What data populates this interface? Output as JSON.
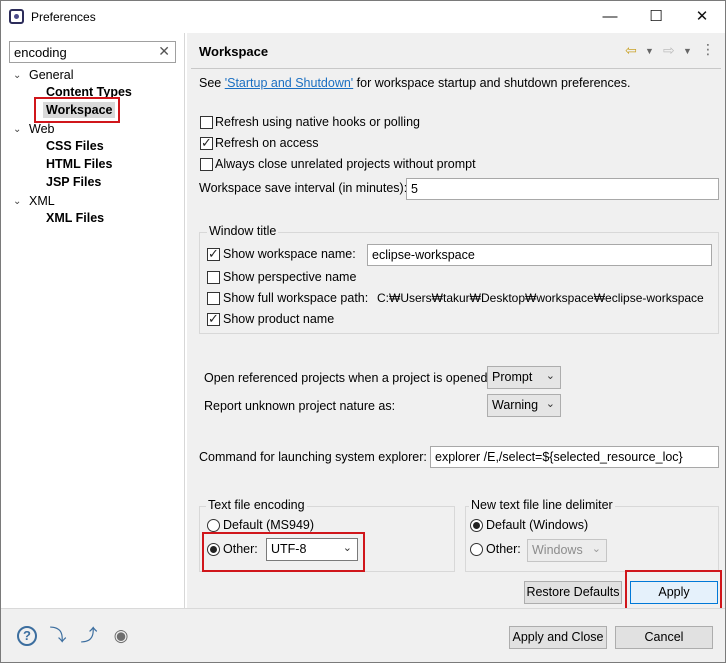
{
  "window": {
    "title": "Preferences",
    "minimize": "—",
    "maximize": "☐",
    "close": "✕"
  },
  "sidebar": {
    "filter_value": "encoding",
    "clear_icon": "✕",
    "tree": [
      {
        "label": "General",
        "expanded": true,
        "children": [
          "Content Types",
          "Workspace"
        ]
      },
      {
        "label": "Web",
        "expanded": true,
        "children": [
          "CSS Files",
          "HTML Files",
          "JSP Files"
        ]
      },
      {
        "label": "XML",
        "expanded": true,
        "children": [
          "XML Files"
        ]
      }
    ],
    "selected": "Workspace"
  },
  "page": {
    "title": "Workspace",
    "see_prefix": "See ",
    "see_link": "'Startup and Shutdown'",
    "see_suffix": " for workspace startup and shutdown preferences.",
    "refresh_native": {
      "label": "Refresh using native hooks or polling",
      "checked": false
    },
    "refresh_access": {
      "label": "Refresh on access",
      "checked": true
    },
    "always_close": {
      "label": "Always close unrelated projects without prompt",
      "checked": false
    },
    "save_interval_label": "Workspace save interval (in minutes):",
    "save_interval_value": "5",
    "window_title": {
      "group_label": "Window title",
      "show_ws_name": {
        "label": "Show workspace name:",
        "checked": true,
        "value": "eclipse-workspace"
      },
      "show_perspective": {
        "label": "Show perspective name",
        "checked": false
      },
      "show_full_path": {
        "label": "Show full workspace path:",
        "checked": false,
        "value": "C:₩Users₩takur₩Desktop₩workspace₩eclipse-workspace"
      },
      "show_product": {
        "label": "Show product name",
        "checked": true
      }
    },
    "open_ref_label": "Open referenced projects when a project is opened:",
    "open_ref_value": "Prompt",
    "report_unknown_label": "Report unknown project nature as:",
    "report_unknown_value": "Warning",
    "cmd_label": "Command for launching system explorer:",
    "cmd_value": "explorer /E,/select=${selected_resource_loc}",
    "encoding": {
      "group_label": "Text file encoding",
      "default_label": "Default (MS949)",
      "other_label": "Other:",
      "other_value": "UTF-8",
      "other_selected": true
    },
    "delimiter": {
      "group_label": "New text file line delimiter",
      "default_label": "Default (Windows)",
      "other_label": "Other:",
      "other_value": "Windows",
      "default_selected": true
    },
    "restore_defaults": "Restore Defaults",
    "apply": "Apply"
  },
  "footer": {
    "icons": [
      "help-icon",
      "import-icon",
      "export-icon",
      "record-icon"
    ],
    "apply_close": "Apply and Close",
    "cancel": "Cancel"
  },
  "highlight_color": "#d0161b"
}
